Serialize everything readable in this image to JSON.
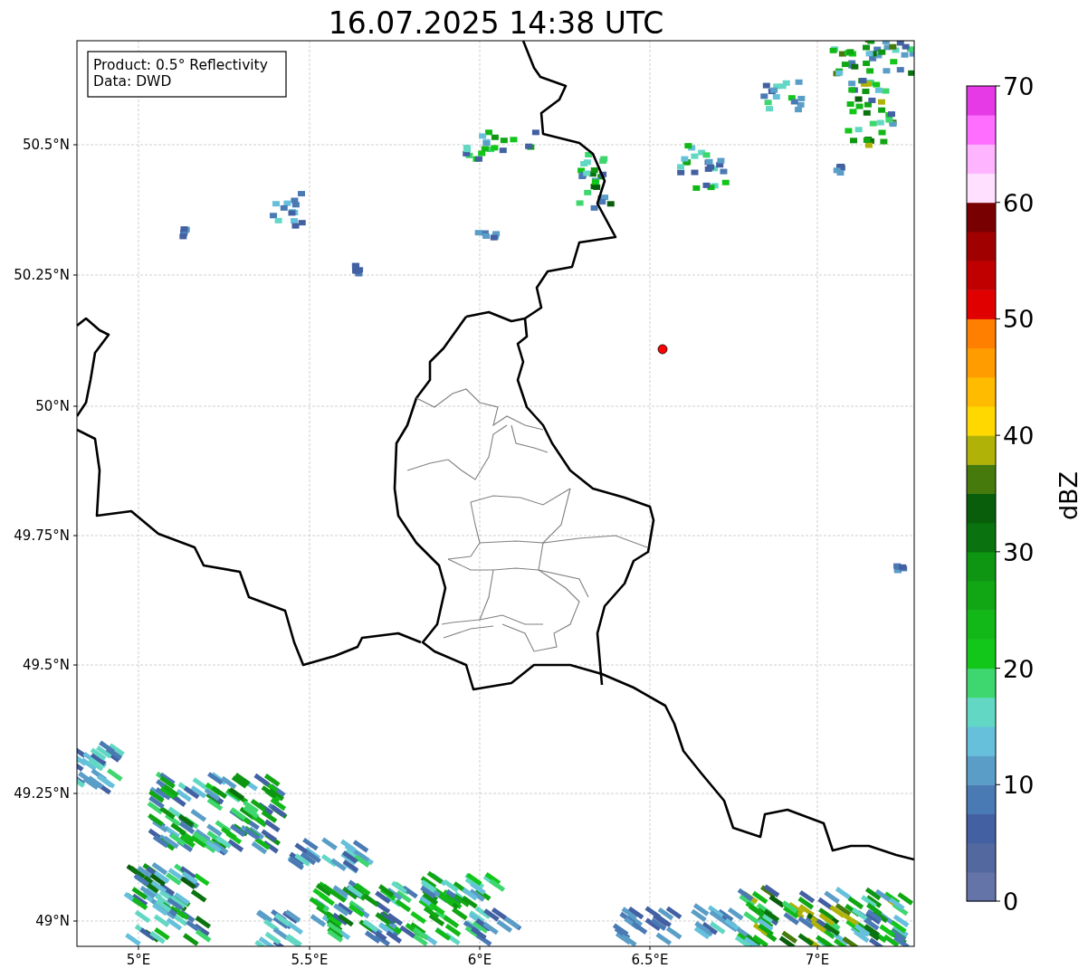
{
  "title": "16.07.2025 14:38 UTC",
  "info_box": {
    "lines": [
      "Product: 0.5° Reflectivity",
      "Data: DWD"
    ]
  },
  "map": {
    "x_ticks": [
      "5°E",
      "5.5°E",
      "6°E",
      "6.5°E",
      "7°E"
    ],
    "y_ticks": [
      "50.5°N",
      "50.25°N",
      "50°N",
      "49.75°N",
      "49.5°N",
      "49.25°N",
      "49°N"
    ]
  },
  "colorbar": {
    "label": "dBZ",
    "ticks": [
      "70",
      "60",
      "50",
      "40",
      "30",
      "20",
      "10",
      "0"
    ],
    "segments": [
      {
        "color": "#6474a8"
      },
      {
        "color": "#52689e"
      },
      {
        "color": "#4260a2"
      },
      {
        "color": "#4a7ab4"
      },
      {
        "color": "#5a9ec8"
      },
      {
        "color": "#66c0dc"
      },
      {
        "color": "#62d8c4"
      },
      {
        "color": "#3ed66e"
      },
      {
        "color": "#12c61a"
      },
      {
        "color": "#12b818"
      },
      {
        "color": "#10a614"
      },
      {
        "color": "#0e9612"
      },
      {
        "color": "#0a720e"
      },
      {
        "color": "#085e0a"
      },
      {
        "color": "#467a0c"
      },
      {
        "color": "#b0b208"
      },
      {
        "color": "#ffd800"
      },
      {
        "color": "#ffbb00"
      },
      {
        "color": "#ff9c00"
      },
      {
        "color": "#ff8000"
      },
      {
        "color": "#e00000"
      },
      {
        "color": "#c00000"
      },
      {
        "color": "#a00000"
      },
      {
        "color": "#780000"
      },
      {
        "color": "#ffe0ff"
      },
      {
        "color": "#ffb4ff"
      },
      {
        "color": "#ff6eff"
      },
      {
        "color": "#e63ae6"
      }
    ]
  }
}
